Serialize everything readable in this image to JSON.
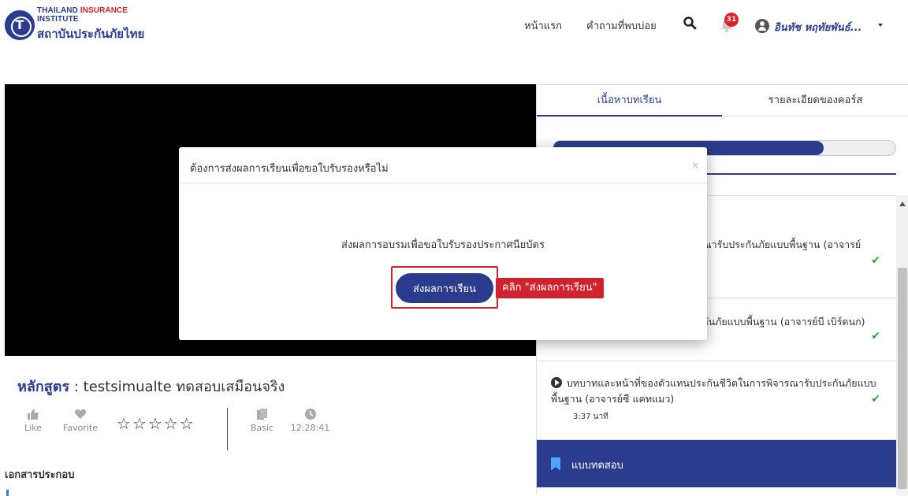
{
  "header": {
    "logo_en_1": "THAILAND",
    "logo_en_2": "INSURANCE",
    "logo_en_3": "INSTITUTE",
    "logo_th": "สถาบันประกันภัยไทย",
    "nav_home": "หน้าแรก",
    "nav_faq": "คำถามที่พบบ่อย",
    "notification_count": "31",
    "user_name": "อินทัช หฤทัยพันธ์...",
    "search_icon": "search-icon",
    "bell_icon": "bell-icon"
  },
  "course": {
    "label": "หลักสูตร",
    "separator": " : ",
    "name": "testsimualte ทดสอบเสมือนจริง",
    "like_label": "Like",
    "favorite_label": "Favorite",
    "stars": "☆☆☆☆☆",
    "level_label": "Basic",
    "duration": "12:28:41",
    "documents_heading": "เอกสารประกอบ"
  },
  "panel": {
    "tab_content": "เนื้อหาบทเรียน",
    "tab_detail": "รายละเอียดของคอร์ส",
    "progress_fraction": 0.79,
    "lessons": [
      {
        "text": "ณารับประกันภัยแบบพื้นฐาน (อาจารย์",
        "check": "✔"
      },
      {
        "text": "กันภัยแบบพื้นฐาน (อาจารย์บี เบิร์ดนก)",
        "check": "✔"
      },
      {
        "text": "บทบาทและหน้าที่ของตัวแทนประกันชีวิตในการพิจารณารับประกันภัยแบบพื้นฐาน (อาจารย์ซี แคทแมว)",
        "duration": "3:37 นาที",
        "check": "✔"
      }
    ],
    "quiz_label": "แบบทดสอบ"
  },
  "modal": {
    "title": "ต้องการส่งผลการเรียนเพื่อขอใบรับรองหรือไม่",
    "close": "×",
    "message": "ส่งผลการอบรมเพื่อขอใบรับรองประกาศนียบัตร",
    "submit_label": "ส่งผลการเรียน",
    "hint": "คลิก \"ส่งผลการเรียน\""
  },
  "colors": {
    "brand": "#2b3c8f",
    "accent_red": "#d2222d",
    "check_green": "#2f9e3d"
  }
}
